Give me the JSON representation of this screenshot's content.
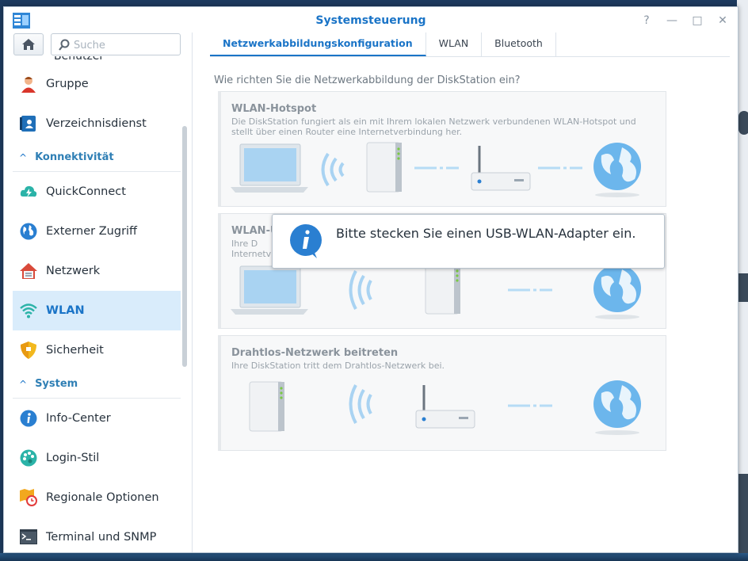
{
  "window": {
    "title": "Systemsteuerung",
    "buttons": [
      "?",
      "—",
      "□",
      "✕"
    ]
  },
  "search": {
    "placeholder": "Suche"
  },
  "sidebar": {
    "partial_item": "Benutzer",
    "items_top": [
      {
        "label": "Gruppe",
        "icon": "group-icon"
      },
      {
        "label": "Verzeichnisdienst",
        "icon": "directory-icon"
      }
    ],
    "section_connectivity": "Konnektivität",
    "items_connectivity": [
      {
        "label": "QuickConnect",
        "icon": "quickconnect-icon"
      },
      {
        "label": "Externer Zugriff",
        "icon": "globe-icon"
      },
      {
        "label": "Netzwerk",
        "icon": "network-house-icon"
      },
      {
        "label": "WLAN",
        "icon": "wifi-icon",
        "active": true
      },
      {
        "label": "Sicherheit",
        "icon": "shield-icon"
      }
    ],
    "section_system": "System",
    "items_system": [
      {
        "label": "Info-Center",
        "icon": "info-icon"
      },
      {
        "label": "Login-Stil",
        "icon": "palette-icon"
      },
      {
        "label": "Regionale Optionen",
        "icon": "clock-map-icon"
      },
      {
        "label": "Terminal und SNMP",
        "icon": "terminal-icon"
      }
    ]
  },
  "tabs": [
    {
      "label": "Netzwerkabbildungskonfiguration",
      "active": true
    },
    {
      "label": "WLAN"
    },
    {
      "label": "Bluetooth"
    }
  ],
  "question": "Wie richten Sie die Netzwerkabbildung der DiskStation ein?",
  "cards": [
    {
      "title": "WLAN-Hotspot",
      "description": "Die DiskStation fungiert als ein mit Ihrem lokalen Netzwerk verbundenen WLAN-Hotspot und stellt über einen Router eine Internetverbindung her."
    },
    {
      "title": "WLAN-Ü",
      "description": "Ihre D\nInternetv"
    },
    {
      "title": "Drahtlos-Netzwerk beitreten",
      "description": "Ihre DiskStation tritt dem Drahtlos-Netzwerk bei."
    }
  ],
  "tooltip": {
    "text": "Bitte stecken Sie einen USB-WLAN-Adapter ein."
  },
  "colors": {
    "accent": "#1a74c7",
    "active_bg": "#d9ecfb",
    "globe": "#5aa9e6"
  }
}
